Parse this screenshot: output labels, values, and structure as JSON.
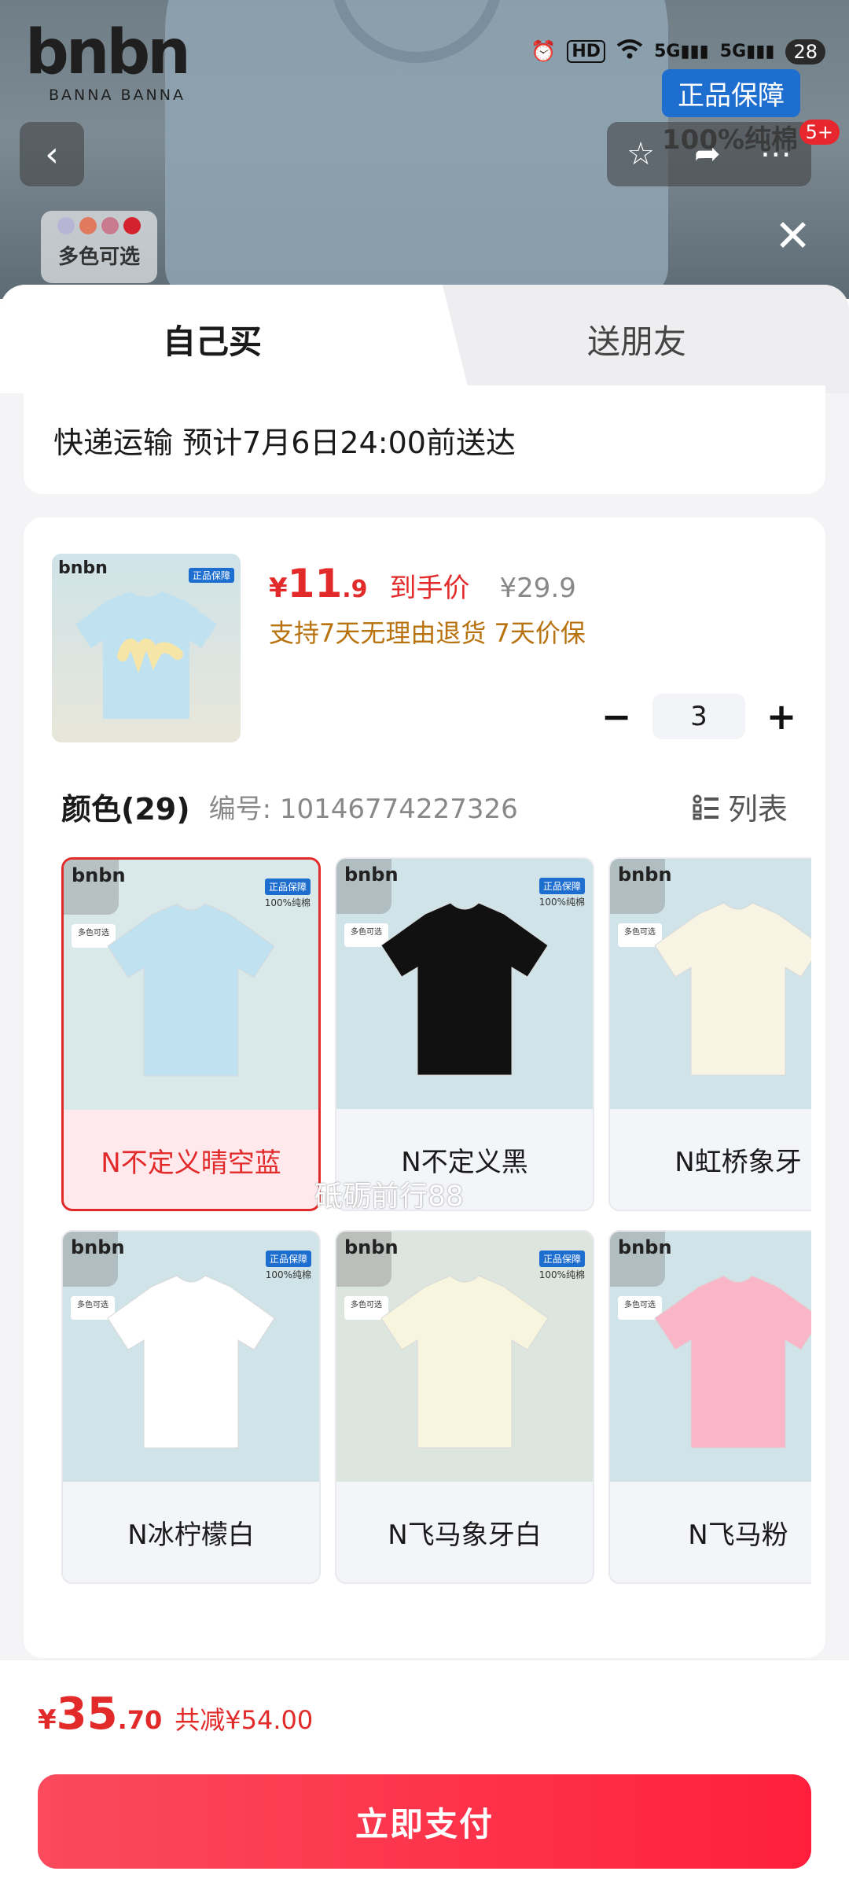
{
  "status_bar": {
    "icons": [
      "alarm-icon",
      "hd-icon",
      "wifi-icon",
      "signal-5g-icon",
      "signal-5g-icon"
    ],
    "battery": "28"
  },
  "brand": {
    "logo": "bnbn",
    "sub": "BANNA  BANNA"
  },
  "background": {
    "badge_genuine": "正品保障",
    "badge_cotton": "100%纯棉",
    "multi_color": "多色可选",
    "count_badge": "5+"
  },
  "tabs": {
    "self": "自己买",
    "friend": "送朋友"
  },
  "delivery": {
    "text": "快递运输 预计7月6日24:00前送达"
  },
  "product": {
    "price_currency": "¥",
    "price_int": "11",
    "price_dec": ".9",
    "price_tag": "到手价",
    "original_price": "¥29.9",
    "promise": "支持7天无理由退货 7天价保",
    "quantity": "3"
  },
  "colors": {
    "title": "颜色(29)",
    "code": "编号: 10146774227326",
    "list_view": "列表",
    "items": [
      {
        "label": "N不定义晴空蓝",
        "selected": true,
        "shirt_color": "#bfe1f0",
        "bg": "#d9e9ea"
      },
      {
        "label": "N不定义黑",
        "selected": false,
        "shirt_color": "#111111",
        "bg": "#cfe3e8"
      },
      {
        "label": "N虹桥象牙",
        "selected": false,
        "shirt_color": "#f7f4e4",
        "bg": "#cfe3e8"
      },
      {
        "label": "N冰柠檬白",
        "selected": false,
        "shirt_color": "#ffffff",
        "bg": "#cfe3e8"
      },
      {
        "label": "N飞马象牙白",
        "selected": false,
        "shirt_color": "#f8f5df",
        "bg": "#dde5df"
      },
      {
        "label": "N飞马粉",
        "selected": false,
        "shirt_color": "#f9b6c8",
        "bg": "#cfe3e8"
      }
    ]
  },
  "watermark": "砥砺前行88",
  "footer": {
    "total_currency": "¥",
    "total_int": "35",
    "total_dec": ".70",
    "saved": "共减¥54.00",
    "pay_button": "立即支付"
  },
  "accent_colors": {
    "price_red": "#e22a2a",
    "pay_gradient_start": "#fa4a5c",
    "pay_gradient_end": "#ff1f3c",
    "badge_blue": "#1d6ecf"
  }
}
